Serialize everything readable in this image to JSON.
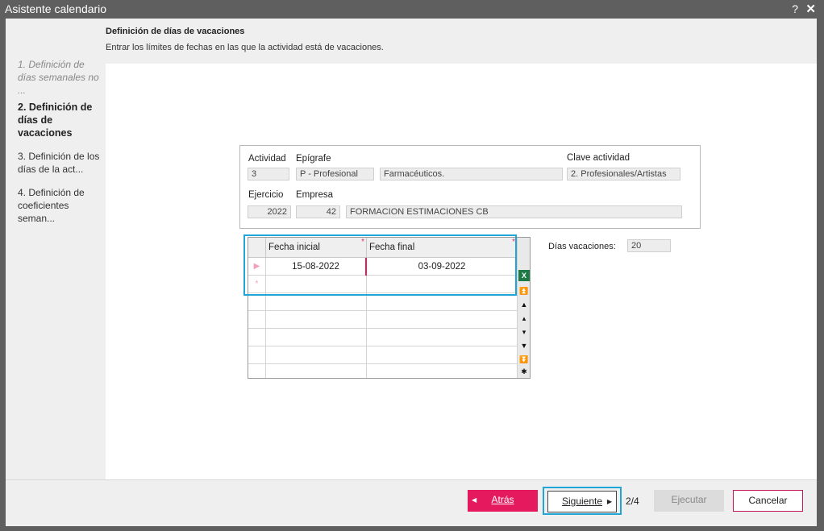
{
  "window": {
    "title": "Asistente calendario",
    "help": "?",
    "close": "✕"
  },
  "steps": [
    {
      "label": "1. Definición de días semanales no ...",
      "state": "done"
    },
    {
      "label": "2. Definición de días de vacaciones",
      "state": "active"
    },
    {
      "label": "3. Definición de los días de la act...",
      "state": "pending"
    },
    {
      "label": "4. Definición de coeficientes seman...",
      "state": "pending"
    }
  ],
  "header": {
    "title": "Definición de días de vacaciones",
    "subtitle": "Entrar los límites de fechas en las que la actividad está de vacaciones."
  },
  "info": {
    "actividad_label": "Actividad",
    "actividad_value": "3",
    "epigrafe_label": "Epígrafe",
    "epigrafe_code": "P - Profesional",
    "epigrafe_desc": "Farmacéuticos.",
    "clave_label": "Clave actividad",
    "clave_value": "2. Profesionales/Artistas",
    "ejercicio_label": "Ejercicio",
    "ejercicio_value": "2022",
    "empresa_label": "Empresa",
    "empresa_code": "42",
    "empresa_name": "FORMACION ESTIMACIONES CB"
  },
  "grid": {
    "columns": [
      "Fecha inicial",
      "Fecha final"
    ],
    "rows": [
      {
        "fecha_inicial": "15-08-2022",
        "fecha_final": "03-09-2022"
      }
    ],
    "new_row_marker": "*",
    "current_row_marker": "▶",
    "excel_icon_label": "X"
  },
  "dias_vacaciones": {
    "label": "Días vacaciones:",
    "value": "20"
  },
  "footer": {
    "back_label": "Atrás",
    "next_label": "Siguiente",
    "page": "2/4",
    "execute_label": "Ejecutar",
    "cancel_label": "Cancelar"
  },
  "colors": {
    "accent": "#e5195e",
    "focus": "#20a6d6",
    "titlebar": "#5f5f5f"
  }
}
